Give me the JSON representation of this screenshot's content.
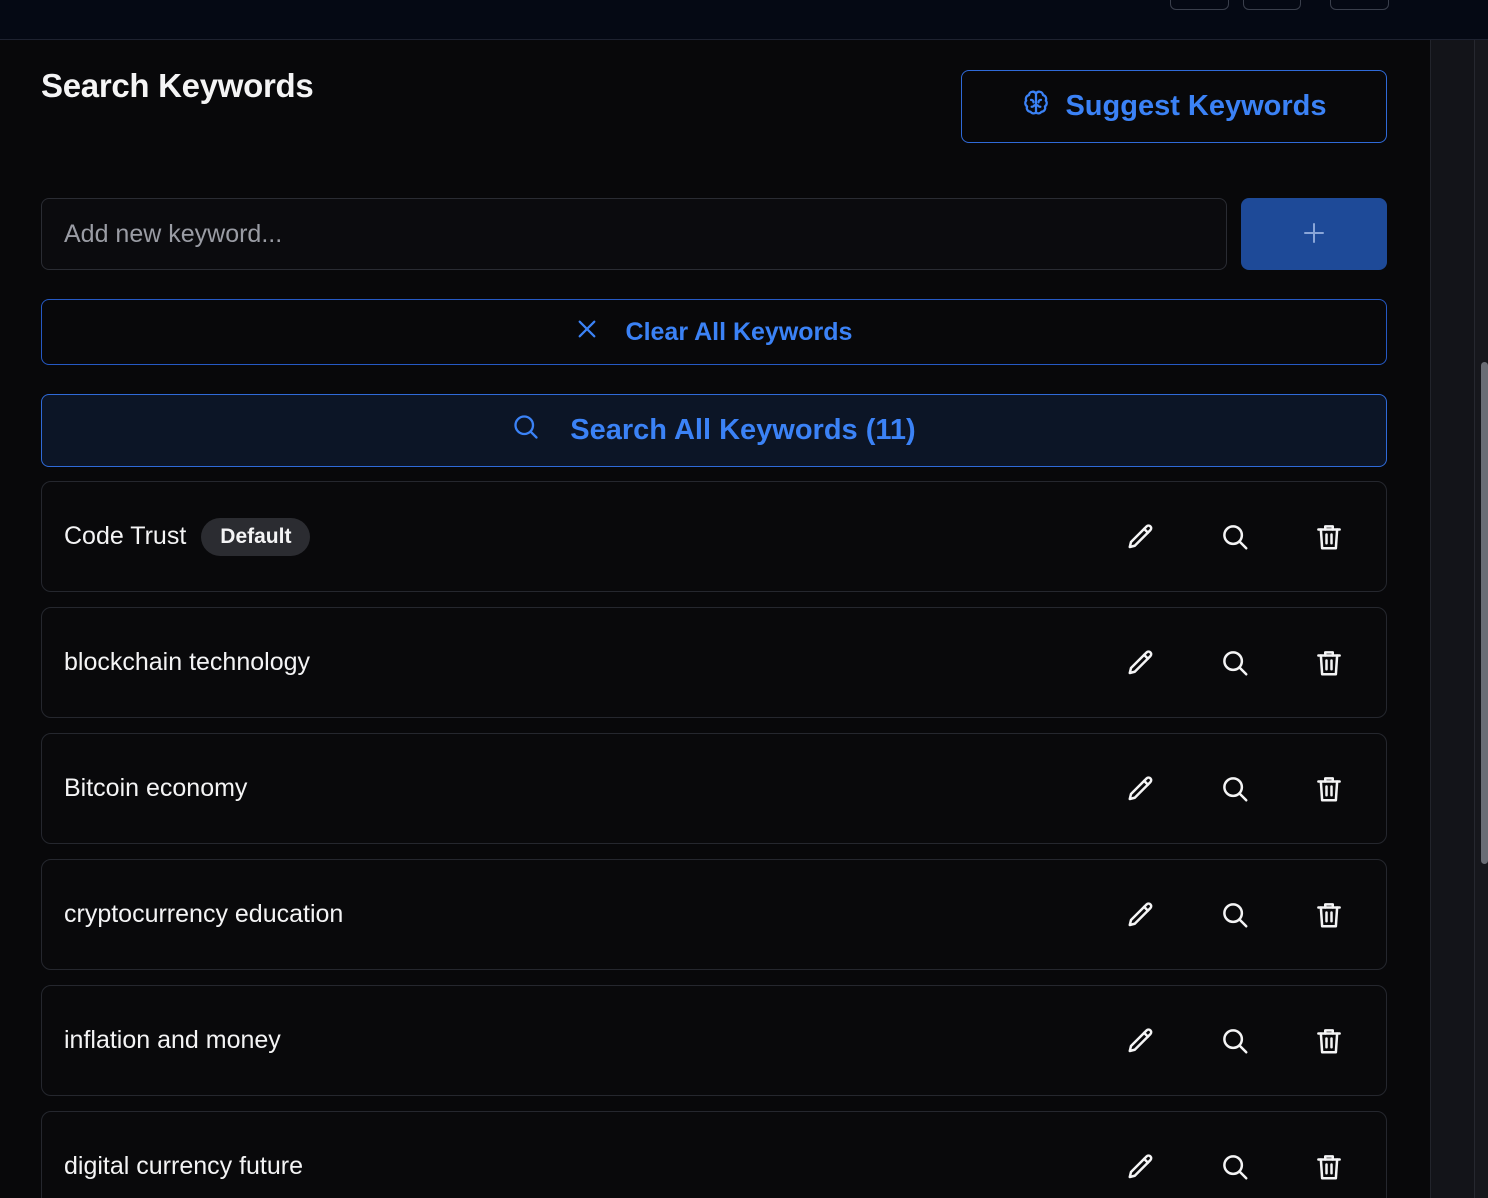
{
  "header": {
    "title": "Search Keywords"
  },
  "suggest_button": {
    "label": "Suggest Keywords",
    "icon": "brain-icon"
  },
  "add_keyword": {
    "placeholder": "Add new keyword...",
    "value": "",
    "button_icon": "plus-icon"
  },
  "clear_button": {
    "label": "Clear All Keywords",
    "icon": "close-icon"
  },
  "search_all_button": {
    "label": "Search All Keywords (11)",
    "icon": "search-icon"
  },
  "keywords": [
    {
      "label": "Code Trust",
      "badge": "Default"
    },
    {
      "label": "blockchain technology"
    },
    {
      "label": "Bitcoin economy"
    },
    {
      "label": "cryptocurrency education"
    },
    {
      "label": "inflation and money"
    },
    {
      "label": "digital currency future"
    }
  ],
  "row_actions": [
    "pencil-icon",
    "search-icon",
    "trash-icon"
  ],
  "colors": {
    "accent": "#3b82f6",
    "accent_border": "#2f6ad8",
    "add_button_bg": "#1e4a98",
    "background": "#08080a",
    "badge_bg": "#2b2c31"
  }
}
